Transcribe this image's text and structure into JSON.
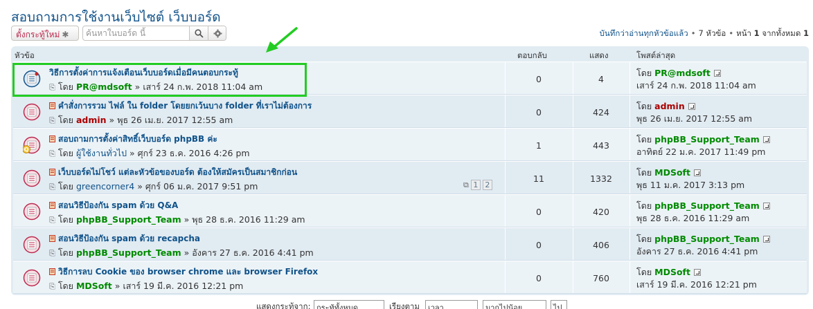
{
  "page_title": "สอบถามการใช้งานเว็บไซต์ เว็บบอร์ด",
  "toolbar": {
    "new_topic_label": "ตั้งกระทู้ใหม่",
    "search_placeholder": "ค้นหาในบอร์ด นี้",
    "pagination_mark_read": "บันทึกว่าอ่านทุกหัวข้อแล้ว",
    "pagination_topics": "7 หัวข้อ",
    "pagination_page_label": "หน้า",
    "pagination_page": "1",
    "pagination_of": "จากทั้งหมด",
    "pagination_total": "1"
  },
  "header": {
    "topics": "หัวข้อ",
    "replies": "ตอบกลับ",
    "views": "แสดง",
    "last_post": "โพสต์ล่าสุด"
  },
  "by_label": "โดย",
  "topics": [
    {
      "title": "วิธีการตั้งค่าการแจ้งเตือนเว็บบอร์ดเมื่อมีคนตอบกระทู้",
      "author": "PR@mdsoft",
      "author_color": "green",
      "date": "เสาร์ 24 ก.พ. 2018 11:04 am",
      "replies": "0",
      "views": "4",
      "last_author": "PR@mdsoft",
      "last_author_color": "green",
      "last_date": "เสาร์ 24 ก.พ. 2018 11:04 am",
      "icon": "unread-topic-icon"
    },
    {
      "title": "คำสั่งการรวม ไฟล์ ใน folder โดยยกเว้นบาง folder ที่เราไม่ต้องการ",
      "author": "admin",
      "author_color": "red",
      "date": "พุธ 26 เม.ย. 2017 12:55 am",
      "replies": "0",
      "views": "424",
      "last_author": "admin",
      "last_author_color": "red",
      "last_date": "พุธ 26 เม.ย. 2017 12:55 am",
      "icon": "read-topic-icon"
    },
    {
      "title": "สอบถามการตั้งค่าสิทธิ์เว็บบอร์ด phpBB ค่ะ",
      "author": "ผู้ใช้งานทั่วไป",
      "author_color": "plain",
      "date": "ศุกร์ 23 ธ.ค. 2016 4:26 pm",
      "replies": "1",
      "views": "443",
      "last_author": "phpBB_Support_Team",
      "last_author_color": "green",
      "last_date": "อาทิตย์ 22 ม.ค. 2017 11:49 pm",
      "icon": "question-topic-icon"
    },
    {
      "title": "เว็บบอร์ดไม่โชว์ แต่ละหัวข้อของบอร์ด ต้องให้สมัครเป็นสมาชิกก่อน",
      "author": "greencorner4",
      "author_color": "plain",
      "date": "ศุกร์ 06 ม.ค. 2017 9:51 pm",
      "replies": "11",
      "views": "1332",
      "last_author": "MDSoft",
      "last_author_color": "green",
      "last_date": "พุธ 11 ม.ค. 2017 3:13 pm",
      "pages": [
        "1",
        "2"
      ],
      "icon": "read-topic-icon"
    },
    {
      "title": "สอนวิธีป้องกัน spam ด้วย Q&A",
      "author": "phpBB_Support_Team",
      "author_color": "green",
      "date": "พุธ 28 ธ.ค. 2016 11:29 am",
      "replies": "0",
      "views": "420",
      "last_author": "phpBB_Support_Team",
      "last_author_color": "green",
      "last_date": "พุธ 28 ธ.ค. 2016 11:29 am",
      "icon": "read-topic-icon"
    },
    {
      "title": "สอนวิธีป้องกัน spam ด้วย recapcha",
      "author": "phpBB_Support_Team",
      "author_color": "green",
      "date": "อังคาร 27 ธ.ค. 2016 4:41 pm",
      "replies": "0",
      "views": "406",
      "last_author": "phpBB_Support_Team",
      "last_author_color": "green",
      "last_date": "อังคาร 27 ธ.ค. 2016 4:41 pm",
      "icon": "read-topic-icon"
    },
    {
      "title": "วิธีการลบ Cookie ของ browser chrome และ browser Firefox",
      "author": "MDSoft",
      "author_color": "green",
      "date": "เสาร์ 19 มี.ค. 2016 12:21 pm",
      "replies": "0",
      "views": "760",
      "last_author": "MDSoft",
      "last_author_color": "green",
      "last_date": "เสาร์ 19 มี.ค. 2016 12:21 pm",
      "icon": "read-topic-icon"
    }
  ],
  "bottom": {
    "display_label": "แสดงกระทู้จาก:",
    "display_value": "กระทู้ทั้งหมด",
    "sort_label": "เรียงตาม",
    "sort_value": "เวลา",
    "order_value": "มากไปน้อย",
    "go_label": "ไป"
  },
  "colors": {
    "link": "#105289",
    "new_topic_text": "#bc2a4d",
    "highlight": "#22cc22",
    "author_green": "#008a00",
    "author_red": "#aa0000"
  }
}
